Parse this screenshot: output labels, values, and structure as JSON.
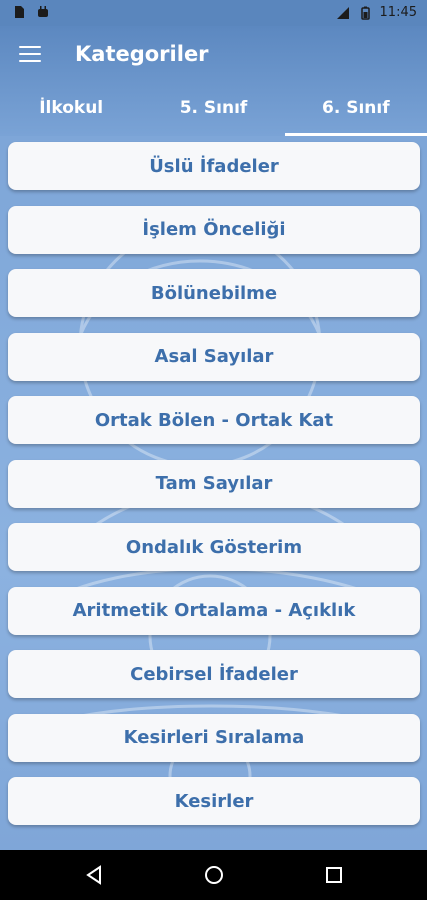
{
  "status_bar": {
    "time": "11:45",
    "network": "LTE",
    "left_icons": [
      "sd-card-icon",
      "android-icon"
    ],
    "right_icons": [
      "signal-icon",
      "battery-icon"
    ]
  },
  "app_bar": {
    "title": "Kategoriler",
    "menu_icon": "hamburger-menu-icon"
  },
  "tabs": [
    {
      "label": "İlkokul",
      "active": false
    },
    {
      "label": "5. Sınıf",
      "active": false
    },
    {
      "label": "6. Sınıf",
      "active": true
    }
  ],
  "categories": [
    "Üslü İfadeler",
    "İşlem Önceliği",
    "Bölünebilme",
    "Asal Sayılar",
    "Ortak Bölen - Ortak Kat",
    "Tam Sayılar",
    "Ondalık Gösterim",
    "Aritmetik Ortalama - Açıklık",
    "Cebirsel İfadeler",
    "Kesirleri Sıralama",
    "Kesirler"
  ],
  "colors": {
    "accent": "#3d6fab",
    "app_bar": "#5c88c0",
    "background": "#7ea6d8",
    "item_bg": "#f7f8fa"
  },
  "nav_bar": {
    "icons": [
      "back-icon",
      "home-icon",
      "recents-icon"
    ]
  }
}
